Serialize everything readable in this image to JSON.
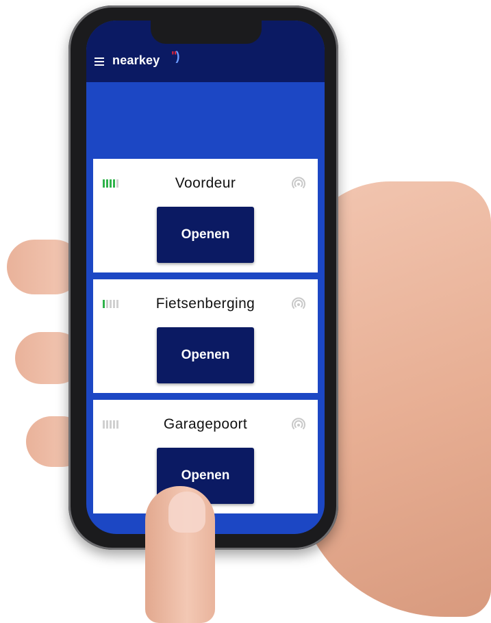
{
  "app": {
    "name": "nearkey",
    "brand_colors": {
      "header": "#0b1a63",
      "background": "#1c47c4",
      "button": "#0b1a63",
      "signal_on": "#2fb34a"
    }
  },
  "doors": [
    {
      "name": "Voordeur",
      "signal_level": 4,
      "button_label": "Openen"
    },
    {
      "name": "Fietsenberging",
      "signal_level": 1,
      "button_label": "Openen"
    },
    {
      "name": "Garagepoort",
      "signal_level": 0,
      "button_label": "Openen"
    }
  ],
  "icons": {
    "menu": "hamburger-menu-icon",
    "nfc": "nfc-signal-icon",
    "signal": "signal-strength-icon"
  }
}
